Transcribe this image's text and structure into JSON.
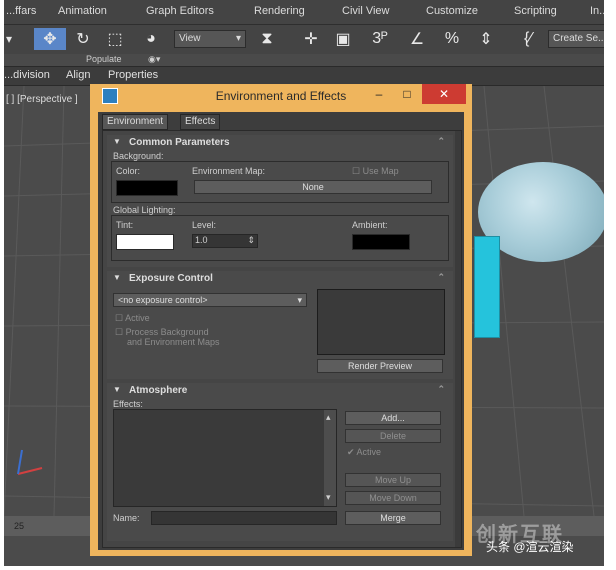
{
  "menu": {
    "items": [
      "...ffars",
      "Animation",
      "Graph Editors",
      "Rendering",
      "Civil View",
      "Customize",
      "Scripting",
      "In..."
    ]
  },
  "toolbar": {
    "view_dropdown": "View",
    "create_selection": "Create Se..."
  },
  "ribbon": {
    "label": "Populate",
    "tabs": [
      "...division",
      "Align",
      "Properties"
    ]
  },
  "viewport": {
    "label": "[ ] [Perspective ]",
    "ruler_tick": "25"
  },
  "dialog": {
    "title": "Environment and Effects",
    "minimize": "–",
    "maximize": "□",
    "close": "✕",
    "tabs": [
      "Environment",
      "Effects"
    ],
    "common_parameters": {
      "header": "Common Parameters",
      "background_label": "Background:",
      "color_label": "Color:",
      "env_map_label": "Environment Map:",
      "use_map_label": "Use Map",
      "map_button": "None",
      "global_lighting_label": "Global Lighting:",
      "tint_label": "Tint:",
      "level_label": "Level:",
      "level_value": "1.0",
      "ambient_label": "Ambient:"
    },
    "exposure_control": {
      "header": "Exposure Control",
      "dropdown_value": "<no exposure control>",
      "active_label": "Active",
      "process_bg_line1": "Process Background",
      "process_bg_line2": "and Environment Maps",
      "render_preview": "Render Preview"
    },
    "atmosphere": {
      "header": "Atmosphere",
      "effects_label": "Effects:",
      "add": "Add...",
      "delete": "Delete",
      "active": "Active",
      "move_up": "Move Up",
      "move_down": "Move Down",
      "name_label": "Name:",
      "merge": "Merge"
    }
  },
  "watermark": {
    "brand": "创新互联",
    "credit": "头条 @渲云渲染"
  },
  "colors": {
    "dialog_frame": "#efb55d",
    "close_button": "#cd3b32",
    "selected_tool": "#5a86c8",
    "sphere": "#a7ccd8",
    "box": "#25c3dc"
  }
}
